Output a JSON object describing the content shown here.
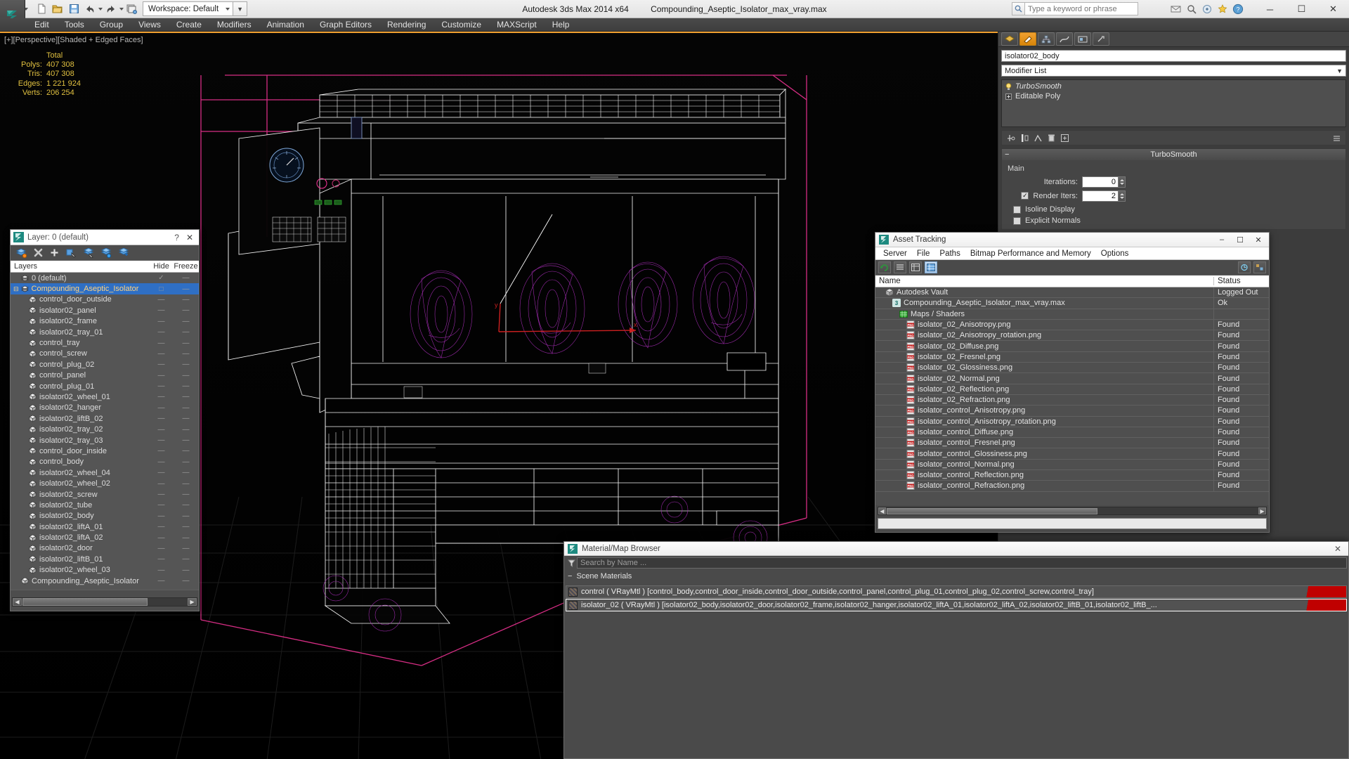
{
  "titlebar": {
    "app_title": "Autodesk 3ds Max  2014 x64",
    "file_title": "Compounding_Aseptic_Isolator_max_vray.max",
    "workspace_label": "Workspace: Default",
    "search_placeholder": "Type a keyword or phrase",
    "minimize": "─",
    "maximize": "☐",
    "close": "✕"
  },
  "menubar": {
    "items": [
      "Edit",
      "Tools",
      "Group",
      "Views",
      "Create",
      "Modifiers",
      "Animation",
      "Graph Editors",
      "Rendering",
      "Customize",
      "MAXScript",
      "Help"
    ]
  },
  "viewport": {
    "label": "[+][Perspective][Shaded + Edged Faces]",
    "stats_header": "Total",
    "stats": [
      {
        "label": "Polys:",
        "value": "407 308"
      },
      {
        "label": "Tris:",
        "value": "407 308"
      },
      {
        "label": "Edges:",
        "value": "1 221 924"
      },
      {
        "label": "Verts:",
        "value": "206 254"
      }
    ],
    "axis_x": "x",
    "axis_y": "y"
  },
  "layer_manager": {
    "title": "Layer: 0 (default)",
    "help": "?",
    "close": "✕",
    "columns": [
      "Layers",
      "Hide",
      "Freeze"
    ],
    "rows": [
      {
        "name": "0 (default)",
        "indent": 1,
        "type": "layer",
        "hide": "✓",
        "freeze": "—",
        "selected": false
      },
      {
        "name": "Compounding_Aseptic_Isolator",
        "indent": 0,
        "type": "layer",
        "hide": "□",
        "freeze": "—",
        "selected": true,
        "expander": "⊟"
      },
      {
        "name": "control_door_outside",
        "indent": 2,
        "type": "object",
        "hide": "—",
        "freeze": "—",
        "selected": false
      },
      {
        "name": "isolator02_panel",
        "indent": 2,
        "type": "object",
        "hide": "—",
        "freeze": "—",
        "selected": false
      },
      {
        "name": "isolator02_frame",
        "indent": 2,
        "type": "object",
        "hide": "—",
        "freeze": "—",
        "selected": false
      },
      {
        "name": "isolator02_tray_01",
        "indent": 2,
        "type": "object",
        "hide": "—",
        "freeze": "—",
        "selected": false
      },
      {
        "name": "control_tray",
        "indent": 2,
        "type": "object",
        "hide": "—",
        "freeze": "—",
        "selected": false
      },
      {
        "name": "control_screw",
        "indent": 2,
        "type": "object",
        "hide": "—",
        "freeze": "—",
        "selected": false
      },
      {
        "name": "control_plug_02",
        "indent": 2,
        "type": "object",
        "hide": "—",
        "freeze": "—",
        "selected": false
      },
      {
        "name": "control_panel",
        "indent": 2,
        "type": "object",
        "hide": "—",
        "freeze": "—",
        "selected": false
      },
      {
        "name": "control_plug_01",
        "indent": 2,
        "type": "object",
        "hide": "—",
        "freeze": "—",
        "selected": false
      },
      {
        "name": "isolator02_wheel_01",
        "indent": 2,
        "type": "object",
        "hide": "—",
        "freeze": "—",
        "selected": false
      },
      {
        "name": "isolator02_hanger",
        "indent": 2,
        "type": "object",
        "hide": "—",
        "freeze": "—",
        "selected": false
      },
      {
        "name": "isolator02_liftB_02",
        "indent": 2,
        "type": "object",
        "hide": "—",
        "freeze": "—",
        "selected": false
      },
      {
        "name": "isolator02_tray_02",
        "indent": 2,
        "type": "object",
        "hide": "—",
        "freeze": "—",
        "selected": false
      },
      {
        "name": "isolator02_tray_03",
        "indent": 2,
        "type": "object",
        "hide": "—",
        "freeze": "—",
        "selected": false
      },
      {
        "name": "control_door_inside",
        "indent": 2,
        "type": "object",
        "hide": "—",
        "freeze": "—",
        "selected": false
      },
      {
        "name": "control_body",
        "indent": 2,
        "type": "object",
        "hide": "—",
        "freeze": "—",
        "selected": false
      },
      {
        "name": "isolator02_wheel_04",
        "indent": 2,
        "type": "object",
        "hide": "—",
        "freeze": "—",
        "selected": false
      },
      {
        "name": "isolator02_wheel_02",
        "indent": 2,
        "type": "object",
        "hide": "—",
        "freeze": "—",
        "selected": false
      },
      {
        "name": "isolator02_screw",
        "indent": 2,
        "type": "object",
        "hide": "—",
        "freeze": "—",
        "selected": false
      },
      {
        "name": "isolator02_tube",
        "indent": 2,
        "type": "object",
        "hide": "—",
        "freeze": "—",
        "selected": false
      },
      {
        "name": "isolator02_body",
        "indent": 2,
        "type": "object",
        "hide": "—",
        "freeze": "—",
        "selected": false
      },
      {
        "name": "isolator02_liftA_01",
        "indent": 2,
        "type": "object",
        "hide": "—",
        "freeze": "—",
        "selected": false
      },
      {
        "name": "isolator02_liftA_02",
        "indent": 2,
        "type": "object",
        "hide": "—",
        "freeze": "—",
        "selected": false
      },
      {
        "name": "isolator02_door",
        "indent": 2,
        "type": "object",
        "hide": "—",
        "freeze": "—",
        "selected": false
      },
      {
        "name": "isolator02_liftB_01",
        "indent": 2,
        "type": "object",
        "hide": "—",
        "freeze": "—",
        "selected": false
      },
      {
        "name": "isolator02_wheel_03",
        "indent": 2,
        "type": "object",
        "hide": "—",
        "freeze": "—",
        "selected": false
      },
      {
        "name": "Compounding_Aseptic_Isolator",
        "indent": 1,
        "type": "object",
        "hide": "—",
        "freeze": "—",
        "selected": false
      }
    ]
  },
  "command_panel": {
    "object_name": "isolator02_body",
    "modifier_list_label": "Modifier List",
    "stack": [
      {
        "label": "TurboSmooth",
        "italic": true
      },
      {
        "label": "Editable Poly",
        "italic": false
      }
    ],
    "rollout_title": "TurboSmooth",
    "section_main": "Main",
    "params": [
      {
        "label": "Iterations:",
        "value": "0"
      },
      {
        "label": "Render Iters:",
        "value": "2",
        "checkbox": true
      }
    ],
    "checkboxes": [
      {
        "label": "Isoline Display",
        "checked": false
      },
      {
        "label": "Explicit Normals",
        "checked": false
      }
    ]
  },
  "asset_tracking": {
    "title": "Asset Tracking",
    "menu": [
      "Server",
      "File",
      "Paths",
      "Bitmap Performance and Memory",
      "Options"
    ],
    "columns": [
      "Name",
      "Status"
    ],
    "rows": [
      {
        "name": "Autodesk Vault",
        "status": "Logged Out",
        "indent": 1,
        "icon": "vault"
      },
      {
        "name": "Compounding_Aseptic_Isolator_max_vray.max",
        "status": "Ok",
        "indent": 2,
        "icon": "max"
      },
      {
        "name": "Maps / Shaders",
        "status": "",
        "indent": 3,
        "icon": "maps"
      },
      {
        "name": "isolator_02_Anisotropy.png",
        "status": "Found",
        "indent": 4,
        "icon": "png"
      },
      {
        "name": "isolator_02_Anisotropy_rotation.png",
        "status": "Found",
        "indent": 4,
        "icon": "png"
      },
      {
        "name": "isolator_02_Diffuse.png",
        "status": "Found",
        "indent": 4,
        "icon": "png"
      },
      {
        "name": "isolator_02_Fresnel.png",
        "status": "Found",
        "indent": 4,
        "icon": "png"
      },
      {
        "name": "isolator_02_Glossiness.png",
        "status": "Found",
        "indent": 4,
        "icon": "png"
      },
      {
        "name": "isolator_02_Normal.png",
        "status": "Found",
        "indent": 4,
        "icon": "png"
      },
      {
        "name": "isolator_02_Reflection.png",
        "status": "Found",
        "indent": 4,
        "icon": "png"
      },
      {
        "name": "isolator_02_Refraction.png",
        "status": "Found",
        "indent": 4,
        "icon": "png"
      },
      {
        "name": "isolator_control_Anisotropy.png",
        "status": "Found",
        "indent": 4,
        "icon": "png"
      },
      {
        "name": "isolator_control_Anisotropy_rotation.png",
        "status": "Found",
        "indent": 4,
        "icon": "png"
      },
      {
        "name": "isolator_control_Diffuse.png",
        "status": "Found",
        "indent": 4,
        "icon": "png"
      },
      {
        "name": "isolator_control_Fresnel.png",
        "status": "Found",
        "indent": 4,
        "icon": "png"
      },
      {
        "name": "isolator_control_Glossiness.png",
        "status": "Found",
        "indent": 4,
        "icon": "png"
      },
      {
        "name": "isolator_control_Normal.png",
        "status": "Found",
        "indent": 4,
        "icon": "png"
      },
      {
        "name": "isolator_control_Reflection.png",
        "status": "Found",
        "indent": 4,
        "icon": "png"
      },
      {
        "name": "isolator_control_Refraction.png",
        "status": "Found",
        "indent": 4,
        "icon": "png"
      }
    ]
  },
  "material_browser": {
    "title": "Material/Map Browser",
    "close": "✕",
    "search_placeholder": "Search by Name ...",
    "section_label": "Scene Materials",
    "materials": [
      {
        "text": "control ( VRayMtl ) [control_body,control_door_inside,control_door_outside,control_panel,control_plug_01,control_plug_02,control_screw,control_tray]",
        "selected": false
      },
      {
        "text": "isolator_02 ( VRayMtl ) [isolator02_body,isolator02_door,isolator02_frame,isolator02_hanger,isolator02_liftA_01,isolator02_liftA_02,isolator02_liftB_01,isolator02_liftB_...",
        "selected": true
      }
    ]
  },
  "colors": {
    "accent_orange": "#f0a030",
    "selection_blue": "#2f6fc4",
    "stats_yellow": "#e0c040",
    "mesh_magenta": "#b030c0",
    "gizmo_red": "#cc2020",
    "panel_bg": "#3c3c3c"
  }
}
